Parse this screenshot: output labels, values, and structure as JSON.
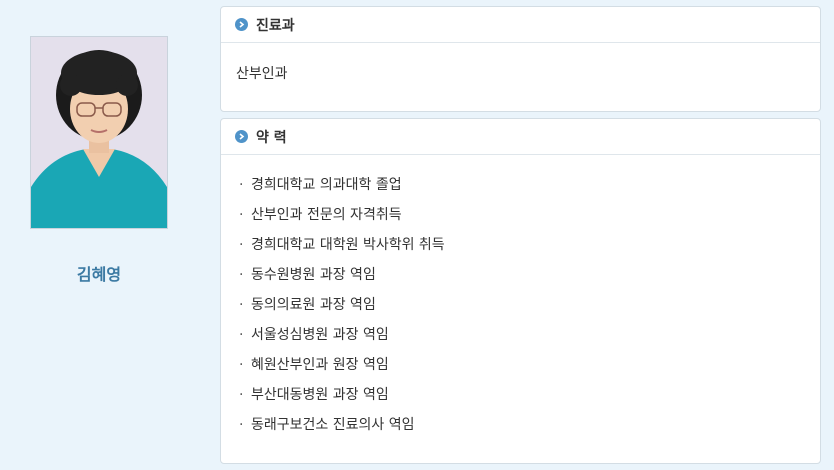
{
  "profile": {
    "name": "김혜영"
  },
  "department": {
    "title": "진료과",
    "value": "산부인과"
  },
  "career": {
    "title": "약 력",
    "items": [
      "경희대학교 의과대학 졸업",
      "산부인과 전문의 자격취득",
      "경희대학교 대학원 박사학위 취득",
      "동수원병원 과장 역임",
      "동의의료원 과장 역임",
      "서울성심병원 과장 역임",
      "혜원산부인과 원장 역임",
      "부산대동병원 과장 역임",
      "동래구보건소 진료의사 역임"
    ]
  },
  "colors": {
    "background": "#eaf4fb",
    "accent": "#4f93c9",
    "name_color": "#3c7aa3"
  }
}
